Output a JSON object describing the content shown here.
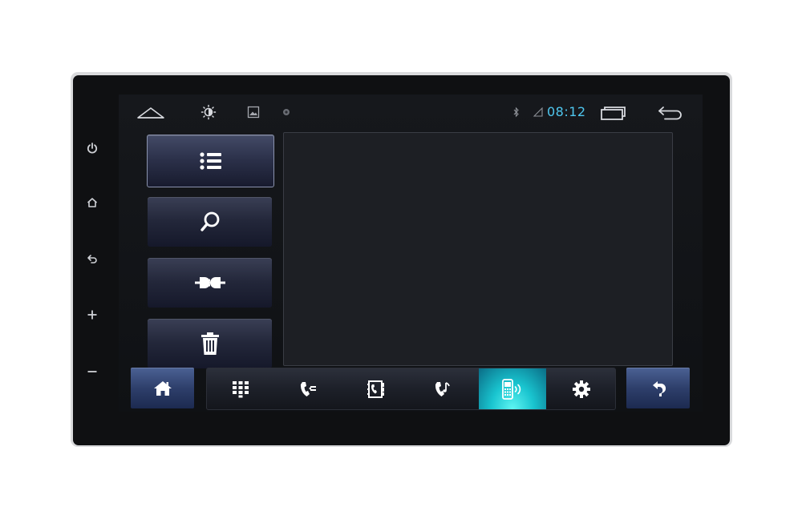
{
  "status_bar": {
    "time": "08:12",
    "icons": [
      "home-outline-icon",
      "brightness-icon",
      "gallery-icon",
      "record-dot-icon",
      "bluetooth-icon",
      "signal-icon",
      "recent-apps-icon",
      "back-arrow-icon"
    ],
    "time_color": "#4fc7ef"
  },
  "hardware_buttons": [
    "power-icon",
    "home-icon",
    "back-icon",
    "volume-up-icon",
    "volume-down-icon"
  ],
  "side_menu": [
    {
      "icon": "list-icon",
      "active": true
    },
    {
      "icon": "search-icon",
      "active": false
    },
    {
      "icon": "pair-plug-icon",
      "active": false
    },
    {
      "icon": "trash-icon",
      "active": false
    }
  ],
  "bottom_bar": {
    "home_button_icon": "home-icon",
    "back_button_icon": "return-arrow-icon",
    "tabs": [
      {
        "icon": "dialpad-icon",
        "active": false
      },
      {
        "icon": "call-log-icon",
        "active": false
      },
      {
        "icon": "contacts-icon",
        "active": false
      },
      {
        "icon": "music-call-icon",
        "active": false
      },
      {
        "icon": "phone-device-icon",
        "active": true
      },
      {
        "icon": "settings-gear-icon",
        "active": false
      }
    ],
    "active_color": "#19c4cf"
  }
}
